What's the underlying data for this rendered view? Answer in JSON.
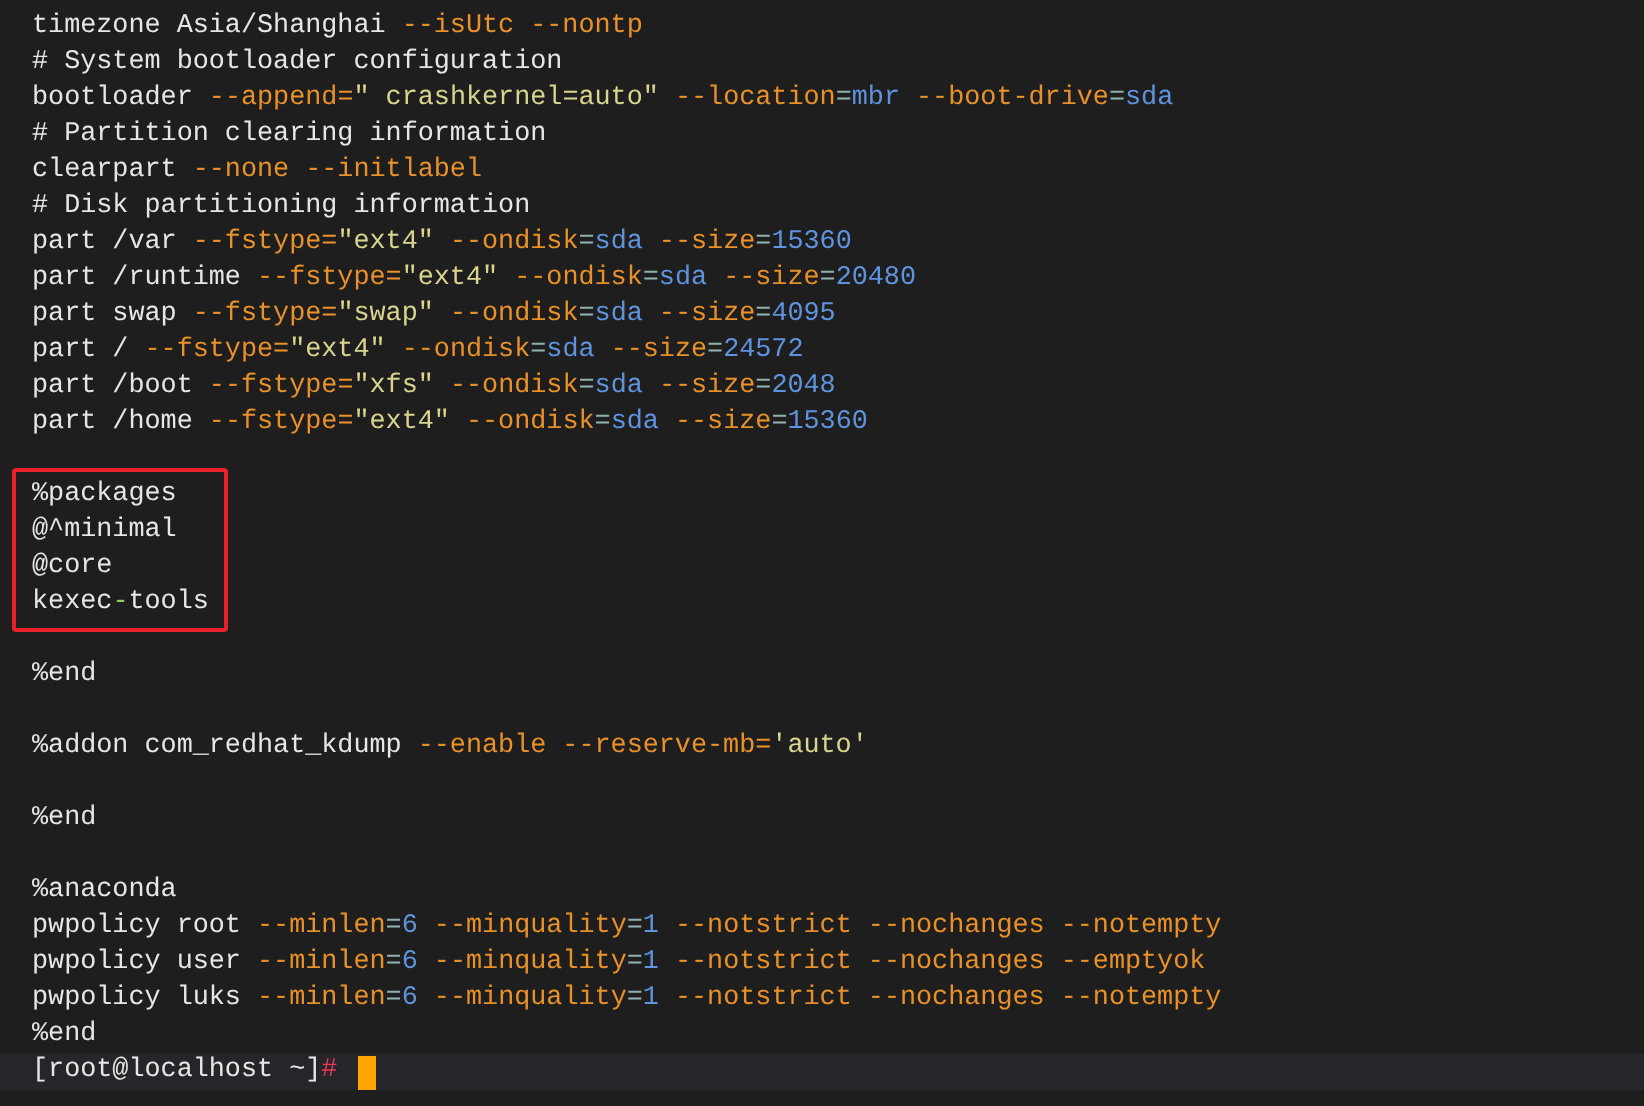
{
  "blocks": [
    {
      "highlighted": false,
      "lines": [
        [
          {
            "text": "timezone Asia/Shanghai ",
            "kind": "plain"
          },
          {
            "text": "--isUtc --nontp",
            "kind": "flag"
          }
        ],
        [
          {
            "text": "# System bootloader configuration",
            "kind": "plain"
          }
        ],
        [
          {
            "text": "bootloader ",
            "kind": "plain"
          },
          {
            "text": "--append=",
            "kind": "flag"
          },
          {
            "text": "\" crashkernel=auto\"",
            "kind": "string"
          },
          {
            "text": " --location",
            "kind": "flag"
          },
          {
            "text": "=",
            "kind": "sym"
          },
          {
            "text": "mbr",
            "kind": "value"
          },
          {
            "text": " --boot-drive",
            "kind": "flag"
          },
          {
            "text": "=",
            "kind": "sym"
          },
          {
            "text": "sda",
            "kind": "value"
          }
        ],
        [
          {
            "text": "# Partition clearing information",
            "kind": "plain"
          }
        ],
        [
          {
            "text": "clearpart ",
            "kind": "plain"
          },
          {
            "text": "--none --initlabel",
            "kind": "flag"
          }
        ],
        [
          {
            "text": "# Disk partitioning information",
            "kind": "plain"
          }
        ],
        [
          {
            "text": "part /var ",
            "kind": "plain"
          },
          {
            "text": "--fstype=",
            "kind": "flag"
          },
          {
            "text": "\"ext4\"",
            "kind": "string"
          },
          {
            "text": " --ondisk",
            "kind": "flag"
          },
          {
            "text": "=",
            "kind": "sym"
          },
          {
            "text": "sda",
            "kind": "value"
          },
          {
            "text": " --size",
            "kind": "flag"
          },
          {
            "text": "=",
            "kind": "sym"
          },
          {
            "text": "15360",
            "kind": "value"
          }
        ],
        [
          {
            "text": "part /runtime ",
            "kind": "plain"
          },
          {
            "text": "--fstype=",
            "kind": "flag"
          },
          {
            "text": "\"ext4\"",
            "kind": "string"
          },
          {
            "text": " --ondisk",
            "kind": "flag"
          },
          {
            "text": "=",
            "kind": "sym"
          },
          {
            "text": "sda",
            "kind": "value"
          },
          {
            "text": " --size",
            "kind": "flag"
          },
          {
            "text": "=",
            "kind": "sym"
          },
          {
            "text": "20480",
            "kind": "value"
          }
        ],
        [
          {
            "text": "part swap ",
            "kind": "plain"
          },
          {
            "text": "--fstype=",
            "kind": "flag"
          },
          {
            "text": "\"swap\"",
            "kind": "string"
          },
          {
            "text": " --ondisk",
            "kind": "flag"
          },
          {
            "text": "=",
            "kind": "sym"
          },
          {
            "text": "sda",
            "kind": "value"
          },
          {
            "text": " --size",
            "kind": "flag"
          },
          {
            "text": "=",
            "kind": "sym"
          },
          {
            "text": "4095",
            "kind": "value"
          }
        ],
        [
          {
            "text": "part / ",
            "kind": "plain"
          },
          {
            "text": "--fstype=",
            "kind": "flag"
          },
          {
            "text": "\"ext4\"",
            "kind": "string"
          },
          {
            "text": " --ondisk",
            "kind": "flag"
          },
          {
            "text": "=",
            "kind": "sym"
          },
          {
            "text": "sda",
            "kind": "value"
          },
          {
            "text": " --size",
            "kind": "flag"
          },
          {
            "text": "=",
            "kind": "sym"
          },
          {
            "text": "24572",
            "kind": "value"
          }
        ],
        [
          {
            "text": "part /boot ",
            "kind": "plain"
          },
          {
            "text": "--fstype=",
            "kind": "flag"
          },
          {
            "text": "\"xfs\"",
            "kind": "string"
          },
          {
            "text": " --ondisk",
            "kind": "flag"
          },
          {
            "text": "=",
            "kind": "sym"
          },
          {
            "text": "sda",
            "kind": "value"
          },
          {
            "text": " --size",
            "kind": "flag"
          },
          {
            "text": "=",
            "kind": "sym"
          },
          {
            "text": "2048",
            "kind": "value"
          }
        ],
        [
          {
            "text": "part /home ",
            "kind": "plain"
          },
          {
            "text": "--fstype=",
            "kind": "flag"
          },
          {
            "text": "\"ext4\"",
            "kind": "string"
          },
          {
            "text": " --ondisk",
            "kind": "flag"
          },
          {
            "text": "=",
            "kind": "sym"
          },
          {
            "text": "sda",
            "kind": "value"
          },
          {
            "text": " --size",
            "kind": "flag"
          },
          {
            "text": "=",
            "kind": "sym"
          },
          {
            "text": "15360",
            "kind": "value"
          }
        ]
      ]
    },
    {
      "highlighted": true,
      "lines": [
        [
          {
            "text": "%packages",
            "kind": "plain"
          }
        ],
        [
          {
            "text": "@^minimal",
            "kind": "plain"
          }
        ],
        [
          {
            "text": "@core",
            "kind": "plain"
          }
        ],
        [
          {
            "text": "kexec",
            "kind": "plain"
          },
          {
            "text": "-",
            "kind": "dash"
          },
          {
            "text": "tools",
            "kind": "plain"
          }
        ]
      ]
    },
    {
      "highlighted": false,
      "lines": [
        [
          {
            "text": "%end",
            "kind": "plain"
          }
        ]
      ]
    },
    {
      "highlighted": false,
      "lines": [
        [
          {
            "text": "%addon com_redhat_kdump ",
            "kind": "plain"
          },
          {
            "text": "--enable --reserve-mb=",
            "kind": "flag"
          },
          {
            "text": "'auto'",
            "kind": "string"
          }
        ]
      ]
    },
    {
      "highlighted": false,
      "lines": [
        [
          {
            "text": "%end",
            "kind": "plain"
          }
        ]
      ]
    },
    {
      "highlighted": false,
      "lines": [
        [
          {
            "text": "%anaconda",
            "kind": "plain"
          }
        ],
        [
          {
            "text": "pwpolicy root ",
            "kind": "plain"
          },
          {
            "text": "--minlen",
            "kind": "flag"
          },
          {
            "text": "=",
            "kind": "sym"
          },
          {
            "text": "6",
            "kind": "value"
          },
          {
            "text": " --minquality",
            "kind": "flag"
          },
          {
            "text": "=",
            "kind": "sym"
          },
          {
            "text": "1",
            "kind": "value"
          },
          {
            "text": " --notstrict --nochanges --notempty",
            "kind": "flag"
          }
        ],
        [
          {
            "text": "pwpolicy user ",
            "kind": "plain"
          },
          {
            "text": "--minlen",
            "kind": "flag"
          },
          {
            "text": "=",
            "kind": "sym"
          },
          {
            "text": "6",
            "kind": "value"
          },
          {
            "text": " --minquality",
            "kind": "flag"
          },
          {
            "text": "=",
            "kind": "sym"
          },
          {
            "text": "1",
            "kind": "value"
          },
          {
            "text": " --notstrict --nochanges --emptyok",
            "kind": "flag"
          }
        ],
        [
          {
            "text": "pwpolicy luks ",
            "kind": "plain"
          },
          {
            "text": "--minlen",
            "kind": "flag"
          },
          {
            "text": "=",
            "kind": "sym"
          },
          {
            "text": "6",
            "kind": "value"
          },
          {
            "text": " --minquality",
            "kind": "flag"
          },
          {
            "text": "=",
            "kind": "sym"
          },
          {
            "text": "1",
            "kind": "value"
          },
          {
            "text": " --notstrict --nochanges --notempty",
            "kind": "flag"
          }
        ],
        [
          {
            "text": "%end",
            "kind": "plain"
          }
        ]
      ]
    }
  ],
  "prompt": {
    "text": "[root@localhost ~]",
    "symbol": "#"
  }
}
